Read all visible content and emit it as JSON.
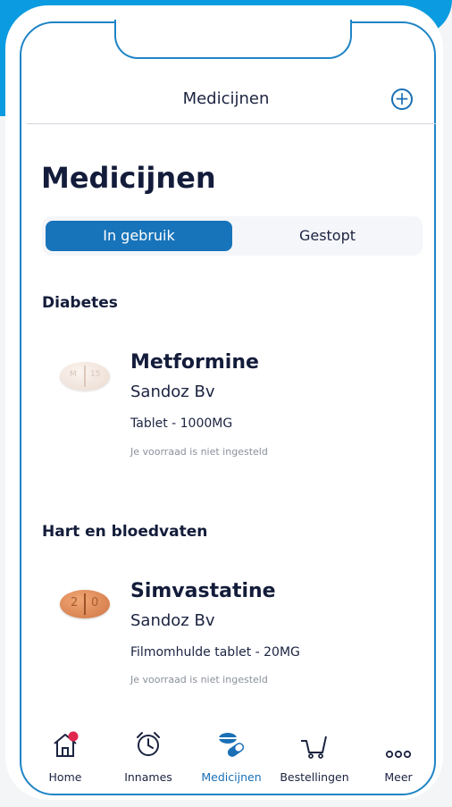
{
  "header": {
    "title": "Medicijnen",
    "add_icon": "plus-circle-icon"
  },
  "page_title": "Medicijnen",
  "segments": {
    "active": "In gebruik",
    "inactive": "Gestopt"
  },
  "sections": [
    {
      "title": "Diabetes",
      "medicines": [
        {
          "name": "Metformine",
          "manufacturer": "Sandoz Bv",
          "form": "Tablet - 1000MG",
          "stock": "Je voorraad is niet ingesteld",
          "pill_icon": "white-oval-tablet-icon"
        }
      ]
    },
    {
      "title": "Hart en bloedvaten",
      "medicines": [
        {
          "name": "Simvastatine",
          "manufacturer": "Sandoz Bv",
          "form": "Filmomhulde tablet - 20MG",
          "stock": "Je voorraad is niet ingesteld",
          "pill_icon": "orange-oval-tablet-icon"
        }
      ]
    }
  ],
  "tabbar": [
    {
      "label": "Home",
      "icon": "home-icon",
      "badge": true
    },
    {
      "label": "Innames",
      "icon": "alarm-clock-icon"
    },
    {
      "label": "Medicijnen",
      "icon": "pills-icon",
      "active": true
    },
    {
      "label": "Bestellingen",
      "icon": "cart-icon"
    },
    {
      "label": "Meer",
      "icon": "more-dots-icon"
    }
  ],
  "colors": {
    "accent": "#1874ba",
    "frame": "#1f84c6",
    "badge": "#e0284f",
    "text": "#131c3a"
  }
}
